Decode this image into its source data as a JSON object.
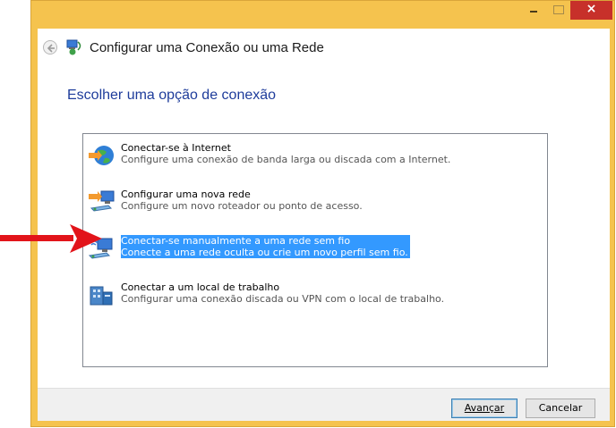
{
  "window": {
    "title": "Configurar uma Conexão ou uma Rede",
    "controls": {
      "minimize": "–",
      "maximize": "□",
      "close": "×"
    }
  },
  "heading": "Escolher uma opção de conexão",
  "options": [
    {
      "title": "Conectar-se à Internet",
      "description": "Configure uma conexão de banda larga ou discada com a Internet.",
      "icon": "globe-network-icon",
      "selected": false
    },
    {
      "title": "Configurar uma nova rede",
      "description": "Configure um novo roteador ou ponto de acesso.",
      "icon": "new-network-icon",
      "selected": false
    },
    {
      "title": "Conectar-se manualmente a uma rede sem fio",
      "description": "Conecte a uma rede oculta ou crie um novo perfil sem fio.",
      "icon": "wireless-network-icon",
      "selected": true
    },
    {
      "title": "Conectar a um local de trabalho",
      "description": "Configurar uma conexão discada ou VPN com o local de trabalho.",
      "icon": "workplace-icon",
      "selected": false
    }
  ],
  "buttons": {
    "next": "Avançar",
    "cancel": "Cancelar"
  },
  "colors": {
    "frame": "#f5c34e",
    "selection": "#3399ff",
    "heading": "#1e3c9b",
    "close": "#c7302a",
    "annotation_arrow": "#e2141a"
  }
}
